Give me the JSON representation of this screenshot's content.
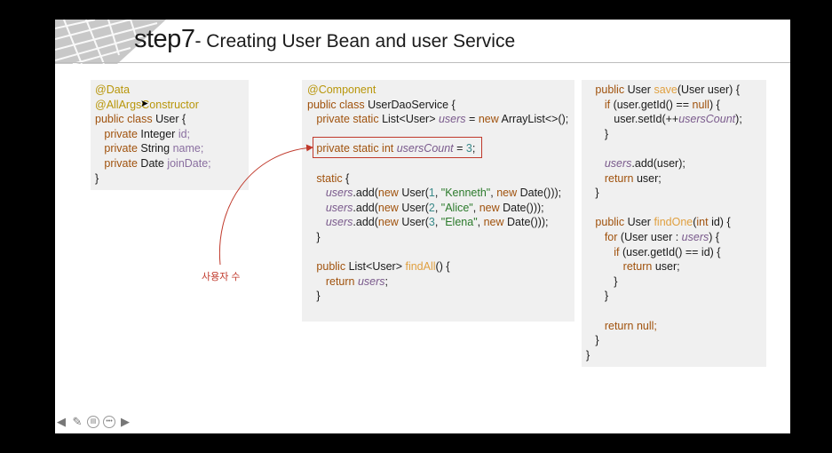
{
  "slide": {
    "title_step": "step7",
    "title_rest": "- Creating User Bean and user Service",
    "annotation": "사용자 수"
  },
  "colors": {
    "keyword": "#a0520d",
    "annotation": "#b8960a",
    "field": "#7a5a8c",
    "method": "#e0a040",
    "string": "#2b7a2b",
    "highlight_border": "#c0392b"
  },
  "code_user": [
    [
      {
        "t": "@Data",
        "c": "an"
      }
    ],
    [
      {
        "t": "@AllArgsConstructor",
        "c": "an"
      }
    ],
    [
      {
        "t": "public class ",
        "c": "kw"
      },
      {
        "t": "User {",
        "c": "pl"
      }
    ],
    [
      {
        "t": "   private ",
        "c": "kw"
      },
      {
        "t": "Integer ",
        "c": "pl"
      },
      {
        "t": "id;",
        "c": "fieldvar"
      }
    ],
    [
      {
        "t": "   private ",
        "c": "kw"
      },
      {
        "t": "String ",
        "c": "pl"
      },
      {
        "t": "name;",
        "c": "fieldvar"
      }
    ],
    [
      {
        "t": "   private ",
        "c": "kw"
      },
      {
        "t": "Date ",
        "c": "pl"
      },
      {
        "t": "joinDate;",
        "c": "fieldvar"
      }
    ],
    [
      {
        "t": "}",
        "c": "pl"
      }
    ]
  ],
  "code_service": [
    [
      {
        "t": "@Component",
        "c": "an"
      }
    ],
    [
      {
        "t": "public class ",
        "c": "kw"
      },
      {
        "t": "UserDaoService {",
        "c": "pl"
      }
    ],
    [
      {
        "t": "   private static ",
        "c": "kw"
      },
      {
        "t": "List<User> ",
        "c": "pl"
      },
      {
        "t": "users",
        "c": "fld"
      },
      {
        "t": " = ",
        "c": "pl"
      },
      {
        "t": "new ",
        "c": "kw"
      },
      {
        "t": "ArrayList<>();",
        "c": "pl"
      }
    ],
    [
      {
        "t": "",
        "c": "pl"
      }
    ],
    [
      {
        "t": "   private static int ",
        "c": "kw"
      },
      {
        "t": "usersCount",
        "c": "fld"
      },
      {
        "t": " = ",
        "c": "pl"
      },
      {
        "t": "3",
        "c": "num"
      },
      {
        "t": ";",
        "c": "pl"
      }
    ],
    [
      {
        "t": "",
        "c": "pl"
      }
    ],
    [
      {
        "t": "   static ",
        "c": "kw"
      },
      {
        "t": "{",
        "c": "pl"
      }
    ],
    [
      {
        "t": "      users",
        "c": "fld"
      },
      {
        "t": ".add(",
        "c": "pl"
      },
      {
        "t": "new ",
        "c": "kw"
      },
      {
        "t": "User(",
        "c": "pl"
      },
      {
        "t": "1",
        "c": "num"
      },
      {
        "t": ", ",
        "c": "pl"
      },
      {
        "t": "\"Kenneth\"",
        "c": "str"
      },
      {
        "t": ", ",
        "c": "pl"
      },
      {
        "t": "new ",
        "c": "kw"
      },
      {
        "t": "Date()));",
        "c": "pl"
      }
    ],
    [
      {
        "t": "      users",
        "c": "fld"
      },
      {
        "t": ".add(",
        "c": "pl"
      },
      {
        "t": "new ",
        "c": "kw"
      },
      {
        "t": "User(",
        "c": "pl"
      },
      {
        "t": "2",
        "c": "num"
      },
      {
        "t": ", ",
        "c": "pl"
      },
      {
        "t": "\"Alice\"",
        "c": "str"
      },
      {
        "t": ", ",
        "c": "pl"
      },
      {
        "t": "new ",
        "c": "kw"
      },
      {
        "t": "Date()));",
        "c": "pl"
      }
    ],
    [
      {
        "t": "      users",
        "c": "fld"
      },
      {
        "t": ".add(",
        "c": "pl"
      },
      {
        "t": "new ",
        "c": "kw"
      },
      {
        "t": "User(",
        "c": "pl"
      },
      {
        "t": "3",
        "c": "num"
      },
      {
        "t": ", ",
        "c": "pl"
      },
      {
        "t": "\"Elena\"",
        "c": "str"
      },
      {
        "t": ", ",
        "c": "pl"
      },
      {
        "t": "new ",
        "c": "kw"
      },
      {
        "t": "Date()));",
        "c": "pl"
      }
    ],
    [
      {
        "t": "   }",
        "c": "pl"
      }
    ],
    [
      {
        "t": "",
        "c": "pl"
      }
    ],
    [
      {
        "t": "   public ",
        "c": "kw"
      },
      {
        "t": "List<User> ",
        "c": "pl"
      },
      {
        "t": "findAll",
        "c": "fn"
      },
      {
        "t": "() {",
        "c": "pl"
      }
    ],
    [
      {
        "t": "      return ",
        "c": "kw"
      },
      {
        "t": "users",
        "c": "fld"
      },
      {
        "t": ";",
        "c": "pl"
      }
    ],
    [
      {
        "t": "   }",
        "c": "pl"
      }
    ]
  ],
  "code_methods": [
    [
      {
        "t": "   public ",
        "c": "kw"
      },
      {
        "t": "User ",
        "c": "pl"
      },
      {
        "t": "save",
        "c": "fn"
      },
      {
        "t": "(User user) {",
        "c": "pl"
      }
    ],
    [
      {
        "t": "      if ",
        "c": "kw"
      },
      {
        "t": "(user.getId() == ",
        "c": "pl"
      },
      {
        "t": "null",
        "c": "kw"
      },
      {
        "t": ") {",
        "c": "pl"
      }
    ],
    [
      {
        "t": "         user.setId(++",
        "c": "pl"
      },
      {
        "t": "usersCount",
        "c": "fld"
      },
      {
        "t": ");",
        "c": "pl"
      }
    ],
    [
      {
        "t": "      }",
        "c": "pl"
      }
    ],
    [
      {
        "t": "",
        "c": "pl"
      }
    ],
    [
      {
        "t": "      users",
        "c": "fld"
      },
      {
        "t": ".add(user);",
        "c": "pl"
      }
    ],
    [
      {
        "t": "      return ",
        "c": "kw"
      },
      {
        "t": "user;",
        "c": "pl"
      }
    ],
    [
      {
        "t": "   }",
        "c": "pl"
      }
    ],
    [
      {
        "t": "",
        "c": "pl"
      }
    ],
    [
      {
        "t": "   public ",
        "c": "kw"
      },
      {
        "t": "User ",
        "c": "pl"
      },
      {
        "t": "findOne",
        "c": "fn"
      },
      {
        "t": "(",
        "c": "pl"
      },
      {
        "t": "int ",
        "c": "kw"
      },
      {
        "t": "id) {",
        "c": "pl"
      }
    ],
    [
      {
        "t": "      for ",
        "c": "kw"
      },
      {
        "t": "(User user : ",
        "c": "pl"
      },
      {
        "t": "users",
        "c": "fld"
      },
      {
        "t": ") {",
        "c": "pl"
      }
    ],
    [
      {
        "t": "         if ",
        "c": "kw"
      },
      {
        "t": "(user.getId() == id) {",
        "c": "pl"
      }
    ],
    [
      {
        "t": "            return ",
        "c": "kw"
      },
      {
        "t": "user;",
        "c": "pl"
      }
    ],
    [
      {
        "t": "         }",
        "c": "pl"
      }
    ],
    [
      {
        "t": "      }",
        "c": "pl"
      }
    ],
    [
      {
        "t": "",
        "c": "pl"
      }
    ],
    [
      {
        "t": "      return null;",
        "c": "kw"
      }
    ],
    [
      {
        "t": "   }",
        "c": "pl"
      }
    ],
    [
      {
        "t": "}",
        "c": "pl"
      }
    ]
  ],
  "toolbar": {
    "prev_icon": "arrow-left-icon",
    "pen_icon": "pen-icon",
    "home_icon": "slide-icon",
    "more_icon": "more-icon",
    "next_icon": "arrow-right-icon"
  }
}
